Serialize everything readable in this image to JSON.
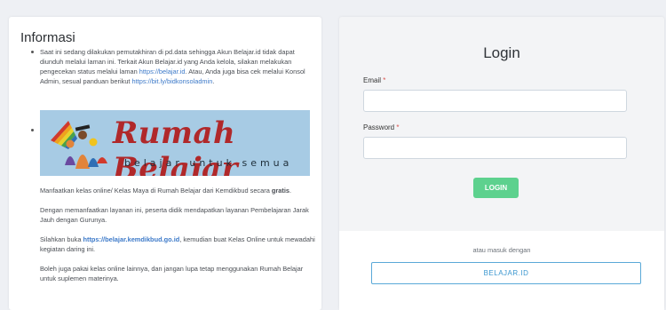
{
  "info": {
    "title": "Informasi",
    "notice_part1": "Saat ini sedang dilakukan pemutakhiran di pd.data sehingga Akun Belajar.id tidak dapat diunduh melalui laman ini. Terkait Akun Belajar.id yang Anda kelola, silakan melakukan pengecekan status melalui laman ",
    "notice_link1": "https://belajar.id",
    "notice_part2": ". Atau, Anda juga bisa cek melalui Konsol Admin, sesual panduan berikut ",
    "notice_link2": "https://bit.ly/bidkonsoladmin",
    "notice_part3": ".",
    "banner_title": "Rumah Belajar",
    "banner_tagline": "belajar untuk semua",
    "p1_text": "Manfaatkan kelas online/ Kelas Maya di Rumah Belajar dari Kemdikbud secara ",
    "p1_bold": "gratis",
    "p1_end": ".",
    "p2": "Dengan memanfaatkan layanan ini, peserta didik mendapatkan layanan Pembelajaran Jarak Jauh dengan Gurunya.",
    "p3_start": "Silahkan buka ",
    "p3_link": "https://belajar.kemdikbud.go.id",
    "p3_end": ", kemudian buat Kelas Online untuk mewadahi kegiatan daring ini.",
    "p4": "Boleh juga pakai kelas online lainnya, dan jangan lupa tetap menggunakan Rumah Belajar untuk suplemen materinya."
  },
  "login": {
    "title": "Login",
    "email_label": "Email",
    "password_label": "Password",
    "required_mark": "*",
    "login_button": "LOGIN",
    "alt_text": "atau masuk dengan",
    "sso_button": "BELAJAR.ID"
  }
}
